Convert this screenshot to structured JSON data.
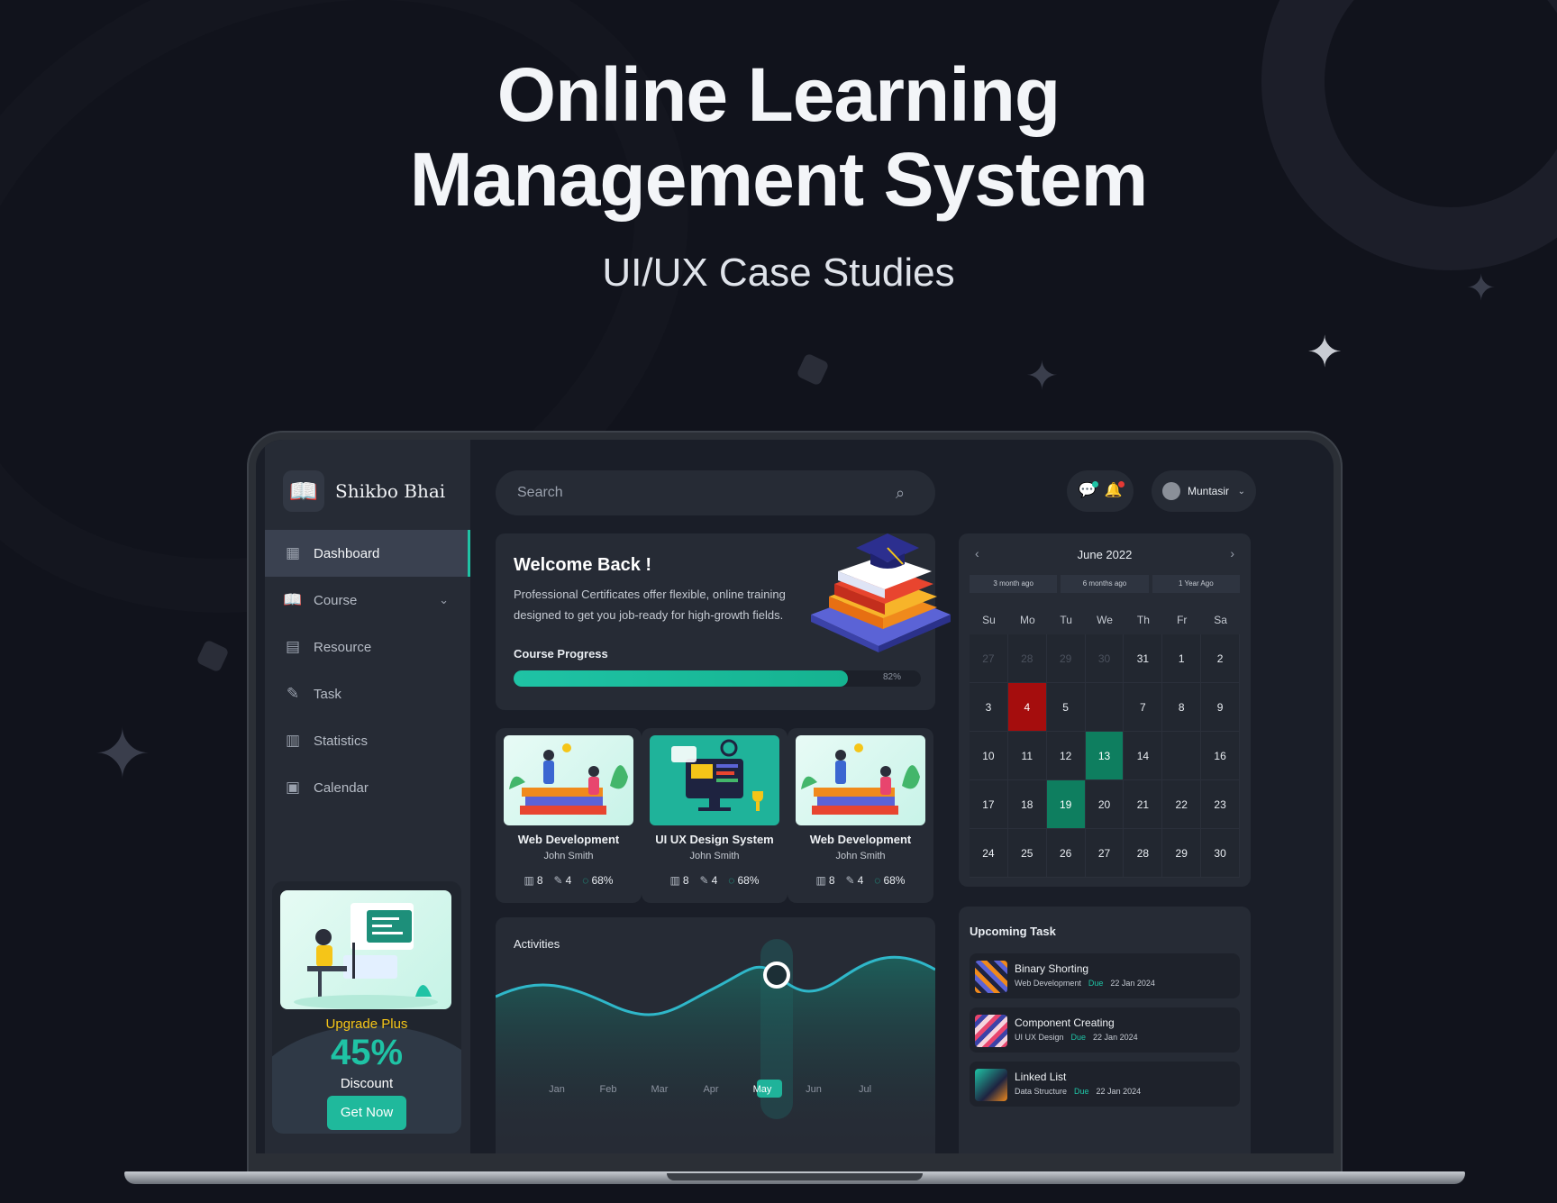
{
  "hero": {
    "title_line1": "Online Learning",
    "title_line2": "Management System",
    "subtitle": "UI/UX Case Studies"
  },
  "brand": {
    "name": "Shikbo Bhai",
    "logo_icon": "book-icon"
  },
  "sidebar": {
    "items": [
      {
        "label": "Dashboard",
        "icon": "dashboard-icon",
        "active": true
      },
      {
        "label": "Course",
        "icon": "book-icon",
        "has_chevron": true
      },
      {
        "label": "Resource",
        "icon": "resource-icon"
      },
      {
        "label": "Task",
        "icon": "task-icon"
      },
      {
        "label": "Statistics",
        "icon": "statistics-icon"
      },
      {
        "label": "Calendar",
        "icon": "calendar-icon"
      }
    ]
  },
  "promo": {
    "title": "Upgrade Plus",
    "percent": "45%",
    "label": "Discount",
    "button": "Get Now"
  },
  "search": {
    "placeholder": "Search"
  },
  "header": {
    "user_name": "Muntasir"
  },
  "welcome": {
    "title": "Welcome Back !",
    "text": "Professional Certificates offer flexible, online training designed to get you job-ready for high-growth fields.",
    "progress_label": "Course Progress",
    "progress_value": 82,
    "progress_text": "82%"
  },
  "courses": [
    {
      "title": "Web Development",
      "author": "John Smith",
      "lessons": "8",
      "tasks": "4",
      "progress": "68%"
    },
    {
      "title": "UI UX Design System",
      "author": "John Smith",
      "lessons": "8",
      "tasks": "4",
      "progress": "68%"
    },
    {
      "title": "Web Development",
      "author": "John Smith",
      "lessons": "8",
      "tasks": "4",
      "progress": "68%"
    }
  ],
  "activities": {
    "title": "Activities",
    "months": [
      "Jan",
      "Feb",
      "Mar",
      "Apr",
      "May",
      "Jun",
      "Jul"
    ],
    "highlight": "May"
  },
  "calendar": {
    "month": "June 2022",
    "filters": [
      "3 month ago",
      "6 months ago",
      "1 Year Ago"
    ],
    "days": [
      "Su",
      "Mo",
      "Tu",
      "We",
      "Th",
      "Fr",
      "Sa"
    ],
    "weeks": [
      [
        "27",
        "28",
        "29",
        "30",
        "31",
        "1",
        "2"
      ],
      [
        "3",
        "4",
        "5",
        "",
        "7",
        "8",
        "9"
      ],
      [
        "10",
        "11",
        "12",
        "13",
        "14",
        "",
        "16"
      ],
      [
        "17",
        "18",
        "19",
        "20",
        "21",
        "22",
        "23"
      ],
      [
        "24",
        "25",
        "26",
        "27",
        "28",
        "29",
        "30"
      ]
    ],
    "muted": [
      "0-0",
      "0-1",
      "0-2",
      "0-3"
    ],
    "red": [
      "1-1"
    ],
    "green": [
      "2-3",
      "3-2"
    ],
    "colors": {
      "red": "#a50d0d",
      "green": "#0e7e5f"
    }
  },
  "upcoming": {
    "title": "Upcoming Task",
    "tasks": [
      {
        "title": "Binary Shorting",
        "category": "Web Development",
        "due_label": "Due",
        "date": "22 Jan 2024"
      },
      {
        "title": "Component Creating",
        "category": "UI UX Design",
        "due_label": "Due",
        "date": "22 Jan 2024"
      },
      {
        "title": "Linked List",
        "category": "Data Structure",
        "due_label": "Due",
        "date": "22 Jan 2024"
      }
    ]
  },
  "colors": {
    "accent": "#1fc3a5",
    "bg": "#11131c",
    "panel": "#262b35"
  }
}
